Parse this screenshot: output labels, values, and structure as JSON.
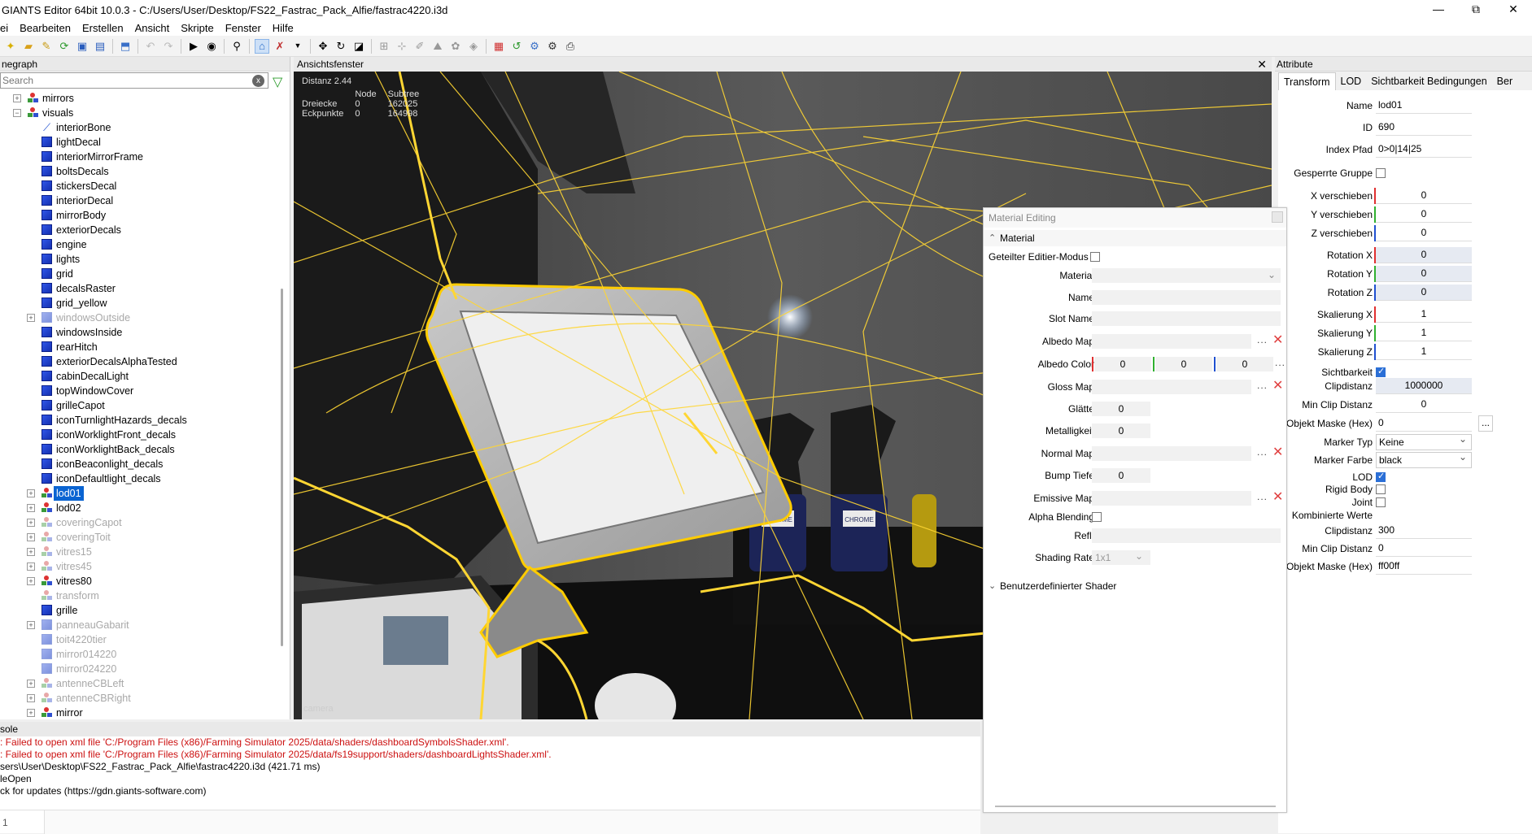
{
  "window": {
    "title": "GIANTS Editor 64bit 10.0.3 - C:/Users/User/Desktop/FS22_Fastrac_Pack_Alfie/fastrac4220.i3d",
    "minimize": "—",
    "maximize": "⧉",
    "close": "✕"
  },
  "menu": [
    "ei",
    "Bearbeiten",
    "Erstellen",
    "Ansicht",
    "Skripte",
    "Fenster",
    "Hilfe"
  ],
  "toolbar_icons": [
    "new-icon",
    "open-icon",
    "edit-icon",
    "refresh-icon",
    "save-icon",
    "save-as-icon",
    "import-icon",
    "undo-icon",
    "redo-icon",
    "play-icon",
    "eye-icon",
    "search-icon",
    "select-icon",
    "select-mode-icon",
    "dropdown-icon",
    "move-icon",
    "rotate-icon",
    "scale-icon",
    "align-icon",
    "snap-icon",
    "paint-icon",
    "terrain-icon",
    "foliage-icon",
    "cube-icon",
    "reload-icon",
    "export-icon",
    "settings-icon",
    "screenshot-icon"
  ],
  "scenegraph": {
    "header": "negraph",
    "search_placeholder": "Search",
    "clear": "x",
    "filter": "▽",
    "items": [
      {
        "label": "mirrors",
        "icon": "tg",
        "exp": "+",
        "indent": 0,
        "dim": false
      },
      {
        "label": "visuals",
        "icon": "tg",
        "exp": "−",
        "indent": 0,
        "dim": false
      },
      {
        "label": "interiorBone",
        "icon": "bone",
        "exp": "",
        "indent": 1,
        "dim": false
      },
      {
        "label": "lightDecal",
        "icon": "cube",
        "exp": "",
        "indent": 1,
        "dim": false
      },
      {
        "label": "interiorMirrorFrame",
        "icon": "cube",
        "exp": "",
        "indent": 1,
        "dim": false
      },
      {
        "label": "boltsDecals",
        "icon": "cube",
        "exp": "",
        "indent": 1,
        "dim": false
      },
      {
        "label": "stickersDecal",
        "icon": "cube",
        "exp": "",
        "indent": 1,
        "dim": false
      },
      {
        "label": "interiorDecal",
        "icon": "cube",
        "exp": "",
        "indent": 1,
        "dim": false
      },
      {
        "label": "mirrorBody",
        "icon": "cube",
        "exp": "",
        "indent": 1,
        "dim": false
      },
      {
        "label": "exteriorDecals",
        "icon": "cube",
        "exp": "",
        "indent": 1,
        "dim": false
      },
      {
        "label": "engine",
        "icon": "cube",
        "exp": "",
        "indent": 1,
        "dim": false
      },
      {
        "label": "lights",
        "icon": "cube",
        "exp": "",
        "indent": 1,
        "dim": false
      },
      {
        "label": "grid",
        "icon": "cube",
        "exp": "",
        "indent": 1,
        "dim": false
      },
      {
        "label": "decalsRaster",
        "icon": "cube",
        "exp": "",
        "indent": 1,
        "dim": false
      },
      {
        "label": "grid_yellow",
        "icon": "cube",
        "exp": "",
        "indent": 1,
        "dim": false
      },
      {
        "label": "windowsOutside",
        "icon": "cube",
        "exp": "+",
        "indent": 1,
        "dim": true
      },
      {
        "label": "windowsInside",
        "icon": "cube",
        "exp": "",
        "indent": 1,
        "dim": false
      },
      {
        "label": "rearHitch",
        "icon": "cube",
        "exp": "",
        "indent": 1,
        "dim": false
      },
      {
        "label": "exteriorDecalsAlphaTested",
        "icon": "cube",
        "exp": "",
        "indent": 1,
        "dim": false
      },
      {
        "label": "cabinDecalLight",
        "icon": "cube",
        "exp": "",
        "indent": 1,
        "dim": false
      },
      {
        "label": "topWindowCover",
        "icon": "cube",
        "exp": "",
        "indent": 1,
        "dim": false
      },
      {
        "label": "grilleCapot",
        "icon": "cube",
        "exp": "",
        "indent": 1,
        "dim": false
      },
      {
        "label": "iconTurnlightHazards_decals",
        "icon": "cube",
        "exp": "",
        "indent": 1,
        "dim": false
      },
      {
        "label": "iconWorklightFront_decals",
        "icon": "cube",
        "exp": "",
        "indent": 1,
        "dim": false
      },
      {
        "label": "iconWorklightBack_decals",
        "icon": "cube",
        "exp": "",
        "indent": 1,
        "dim": false
      },
      {
        "label": "iconBeaconlight_decals",
        "icon": "cube",
        "exp": "",
        "indent": 1,
        "dim": false
      },
      {
        "label": "iconDefaultlight_decals",
        "icon": "cube",
        "exp": "",
        "indent": 1,
        "dim": false
      },
      {
        "label": "lod01",
        "icon": "tg",
        "exp": "+",
        "indent": 1,
        "dim": false,
        "selected": true
      },
      {
        "label": "lod02",
        "icon": "tg",
        "exp": "+",
        "indent": 1,
        "dim": false
      },
      {
        "label": "coveringCapot",
        "icon": "tg",
        "exp": "+",
        "indent": 1,
        "dim": true
      },
      {
        "label": "coveringToit",
        "icon": "tg",
        "exp": "+",
        "indent": 1,
        "dim": true
      },
      {
        "label": "vitres15",
        "icon": "tg",
        "exp": "+",
        "indent": 1,
        "dim": true
      },
      {
        "label": "vitres45",
        "icon": "tg",
        "exp": "+",
        "indent": 1,
        "dim": true
      },
      {
        "label": "vitres80",
        "icon": "tg",
        "exp": "+",
        "indent": 1,
        "dim": false
      },
      {
        "label": "transform",
        "icon": "tg",
        "exp": "",
        "indent": 1,
        "dim": true
      },
      {
        "label": "grille",
        "icon": "cube",
        "exp": "",
        "indent": 1,
        "dim": false
      },
      {
        "label": "panneauGabarit",
        "icon": "cube",
        "exp": "+",
        "indent": 1,
        "dim": true
      },
      {
        "label": "toit4220tier",
        "icon": "cube",
        "exp": "",
        "indent": 1,
        "dim": true
      },
      {
        "label": "mirror014220",
        "icon": "cube",
        "exp": "",
        "indent": 1,
        "dim": true
      },
      {
        "label": "mirror024220",
        "icon": "cube",
        "exp": "",
        "indent": 1,
        "dim": true
      },
      {
        "label": "antenneCBLeft",
        "icon": "tg",
        "exp": "+",
        "indent": 1,
        "dim": true
      },
      {
        "label": "antenneCBRight",
        "icon": "tg",
        "exp": "+",
        "indent": 1,
        "dim": true
      },
      {
        "label": "mirror",
        "icon": "tg",
        "exp": "+",
        "indent": 1,
        "dim": false
      }
    ]
  },
  "viewport": {
    "header": "Ansichtsfenster",
    "close": "✕",
    "distance": "Distanz 2.44",
    "col_node": "Node",
    "col_subtree": "Subtree",
    "row1_label": "Dreiecke",
    "row1_node": "0",
    "row1_subtree": "162025",
    "row2_label": "Eckpunkte",
    "row2_node": "0",
    "row2_subtree": "164998",
    "camera": "camera",
    "bottle_label1": "CHROME",
    "bottle_label2": "CHROME"
  },
  "material_editing": {
    "title": "Material Editing",
    "section_material": "Material",
    "shared_edit_mode": "Geteilter Editier-Modus",
    "material_label": "Material",
    "name_label": "Name",
    "slot_name_label": "Slot Name",
    "albedo_map_label": "Albedo Map",
    "albedo_color_label": "Albedo Color",
    "albedo_color_values": [
      "0",
      "0",
      "0"
    ],
    "gloss_map_label": "Gloss Map",
    "smoothness_label": "Glätte",
    "smoothness_value": "0",
    "metallic_label": "Metalligkeit",
    "metallic_value": "0",
    "normal_map_label": "Normal Map",
    "bump_depth_label": "Bump Tiefe",
    "bump_depth_value": "0",
    "emissive_map_label": "Emissive Map",
    "alpha_blending_label": "Alpha Blending",
    "refl_label": "Refl.",
    "shading_rate_label": "Shading Rate",
    "shading_rate_value": "1x1",
    "section_custom_shader": "Benutzerdefinierter Shader",
    "dots": "...",
    "clear_x": "✕"
  },
  "attributes": {
    "header": "Attribute",
    "tabs": [
      "Transform",
      "LOD",
      "Sichtbarkeit Bedingungen",
      "Ber"
    ],
    "name_label": "Name",
    "name_value": "lod01",
    "id_label": "ID",
    "id_value": "690",
    "index_label": "Index Pfad",
    "index_value": "0>0|14|25",
    "locked_label": "Gesperrte Gruppe",
    "tx_label": "X verschieben",
    "tx_value": "0",
    "ty_label": "Y verschieben",
    "ty_value": "0",
    "tz_label": "Z verschieben",
    "tz_value": "0",
    "rx_label": "Rotation X",
    "rx_value": "0",
    "ry_label": "Rotation Y",
    "ry_value": "0",
    "rz_label": "Rotation Z",
    "rz_value": "0",
    "sx_label": "Skalierung X",
    "sx_value": "1",
    "sy_label": "Skalierung Y",
    "sy_value": "1",
    "sz_label": "Skalierung Z",
    "sz_value": "1",
    "visibility_label": "Sichtbarkeit",
    "clip_label": "Clipdistanz",
    "clip_value": "1000000",
    "minclip_label": "Min Clip Distanz",
    "minclip_value": "0",
    "mask_label": "Objekt Maske (Hex)",
    "mask_value": "0",
    "mask_btn": "...",
    "marker_type_label": "Marker Typ",
    "marker_type_value": "Keine",
    "marker_color_label": "Marker Farbe",
    "marker_color_value": "black",
    "lod_label": "LOD",
    "rigid_label": "Rigid Body",
    "joint_label": "Joint",
    "combined_label": "Kombinierte Werte",
    "c_clip_label": "Clipdistanz",
    "c_clip_value": "300",
    "c_minclip_label": "Min Clip Distanz",
    "c_minclip_value": "0",
    "c_mask_label": "Objekt Maske (Hex)",
    "c_mask_value": "ff00ff"
  },
  "console": {
    "header": "sole",
    "lines": [
      {
        "text": ": Failed to open xml file 'C:/Program Files (x86)/Farming Simulator 2025/data/shaders/dashboardSymbolsShader.xml'.",
        "error": true
      },
      {
        "text": ": Failed to open xml file 'C:/Program Files (x86)/Farming Simulator 2025/data/fs19support/shaders/dashboardLightsShader.xml'.",
        "error": true
      },
      {
        "text": "sers\\User\\Desktop\\FS22_Fastrac_Pack_Alfie\\fastrac4220.i3d (421.71 ms)",
        "error": false
      },
      {
        "text": "leOpen",
        "error": false
      },
      {
        "text": "ck for updates (https://gdn.giants-software.com)",
        "error": false
      }
    ],
    "line_number": "1"
  },
  "colors": {
    "selection": "#0a64d2",
    "error": "#cc1111",
    "wire": "#ffd633",
    "axis_x": "#e03030",
    "axis_y": "#30b030",
    "axis_z": "#2050d0"
  }
}
